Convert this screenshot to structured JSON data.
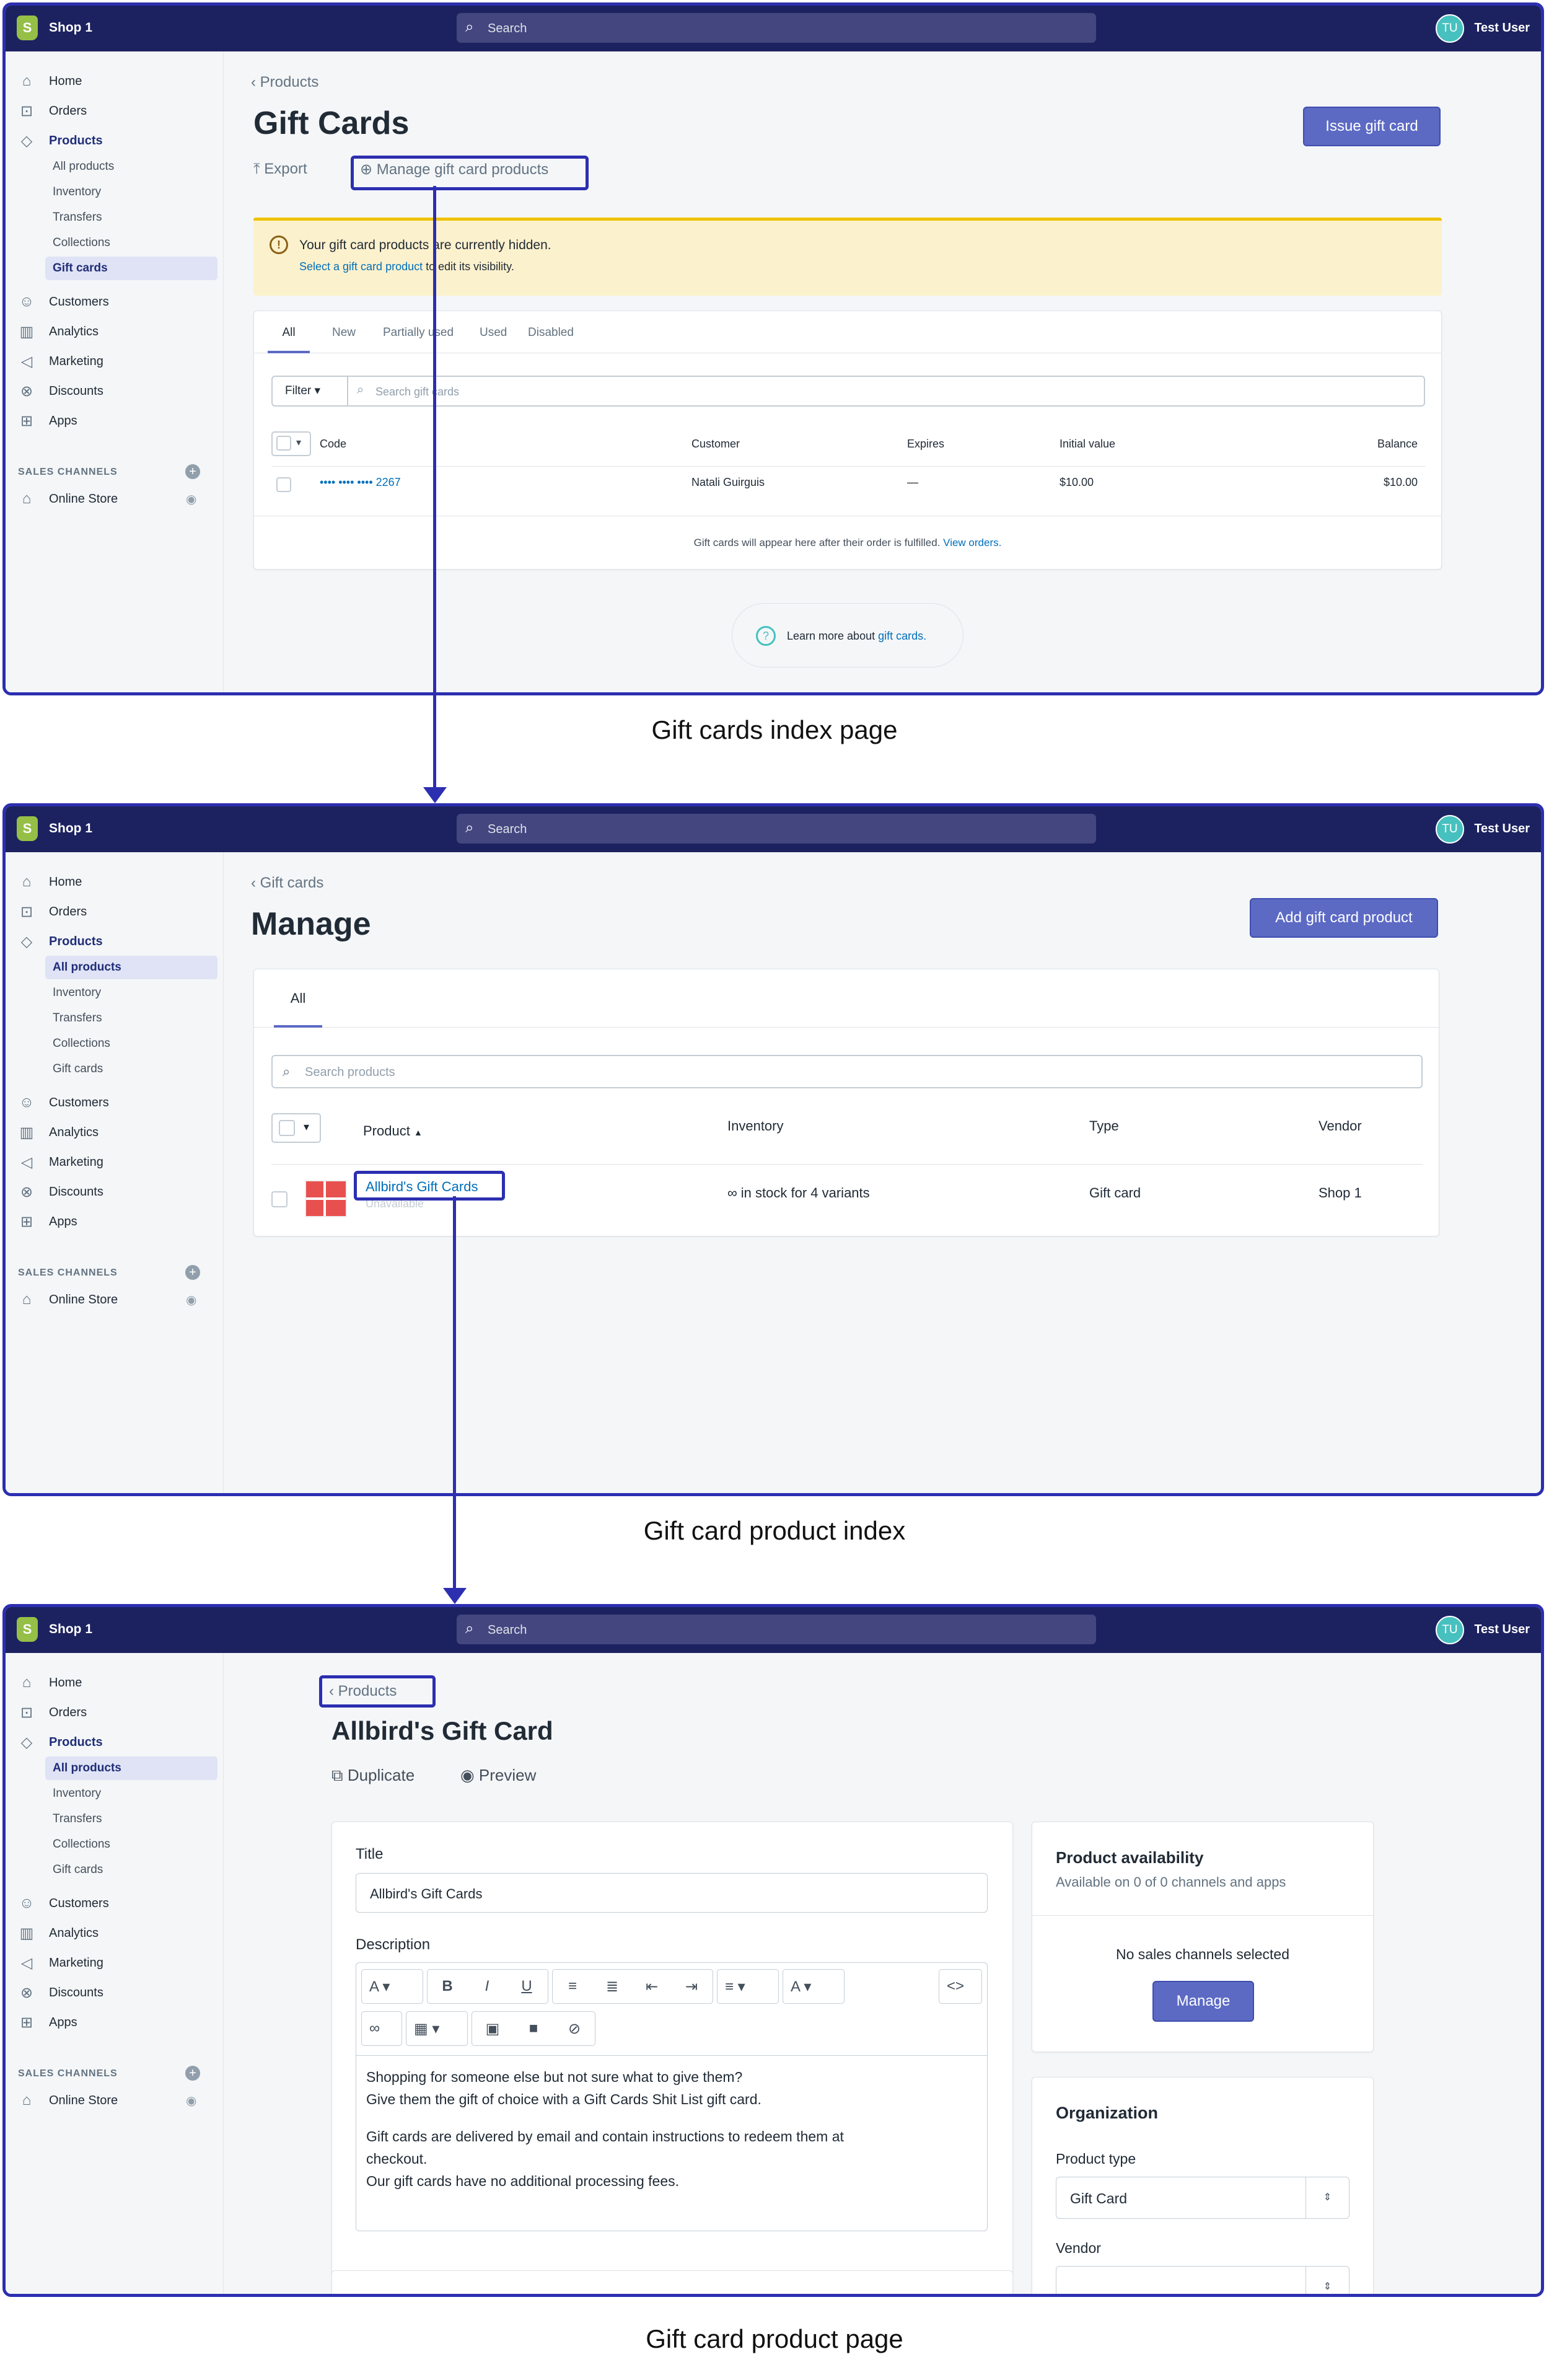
{
  "topbar": {
    "shop_name": "Shop 1",
    "search_placeholder": "Search",
    "user_initials": "TU",
    "user_name": "Test User"
  },
  "sidebar": {
    "home": "Home",
    "orders": "Orders",
    "products": "Products",
    "sub": [
      "All products",
      "Inventory",
      "Transfers",
      "Collections",
      "Gift cards"
    ],
    "customers": "Customers",
    "analytics": "Analytics",
    "marketing": "Marketing",
    "discounts": "Discounts",
    "apps": "Apps",
    "sales_channels": "SALES CHANNELS",
    "online_store": "Online Store"
  },
  "screen1": {
    "back": "Products",
    "title": "Gift Cards",
    "issue_button": "Issue gift card",
    "export": "Export",
    "manage": "Manage gift card products",
    "banner_title": "Your gift card products are currently hidden.",
    "banner_link": "Select a gift card product",
    "banner_rest": "to edit its visibility.",
    "tabs": [
      "All",
      "New",
      "Partially used",
      "Used",
      "Disabled"
    ],
    "filter": "Filter",
    "search_placeholder": "Search gift cards",
    "columns": [
      "Code",
      "Customer",
      "Expires",
      "Initial value",
      "Balance"
    ],
    "row": {
      "code": "•••• •••• •••• 2267",
      "customer": "Natali Guirguis",
      "expires": "—",
      "initial": "$10.00",
      "balance": "$10.00"
    },
    "footer_text": "Gift cards will appear here after their order is fulfilled.",
    "footer_link": "View orders.",
    "learn_text": "Learn more about",
    "learn_link": "gift cards."
  },
  "caption1": "Gift cards index page",
  "screen2": {
    "back": "Gift cards",
    "title": "Manage",
    "add_button": "Add gift card product",
    "tab": "All",
    "search_placeholder": "Search products",
    "columns": [
      "Product",
      "Inventory",
      "Type",
      "Vendor"
    ],
    "row": {
      "product": "Allbird's Gift Cards",
      "status": "Unavailable",
      "inventory": "∞ in stock for 4 variants",
      "type": "Gift card",
      "vendor": "Shop 1"
    }
  },
  "caption2": "Gift card product index",
  "screen3": {
    "back": "Products",
    "title": "Allbird's Gift Card",
    "duplicate": "Duplicate",
    "preview": "Preview",
    "title_label": "Title",
    "title_value": "Allbird's Gift Cards",
    "description_label": "Description",
    "description_lines": [
      "Shopping for someone else but not sure what to give them?",
      "Give them the gift of choice with a Gift Cards Shit List gift card.",
      "",
      "Gift cards are delivered by email and contain instructions to redeem them at",
      "checkout.",
      "Our gift cards have no additional processing fees."
    ],
    "availability_title": "Product availability",
    "availability_sub": "Available on 0 of 0 channels and apps",
    "no_channels": "No sales channels selected",
    "manage_button": "Manage",
    "organization": "Organization",
    "product_type_label": "Product type",
    "product_type_value": "Gift Card",
    "vendor_label": "Vendor"
  },
  "caption3": "Gift card product page",
  "colors": {
    "accent": "#2c2fb0",
    "topbar": "#1c2260",
    "primary_button": "#5c6ac4",
    "banner": "#fcf1cd",
    "link": "#006fbb"
  }
}
